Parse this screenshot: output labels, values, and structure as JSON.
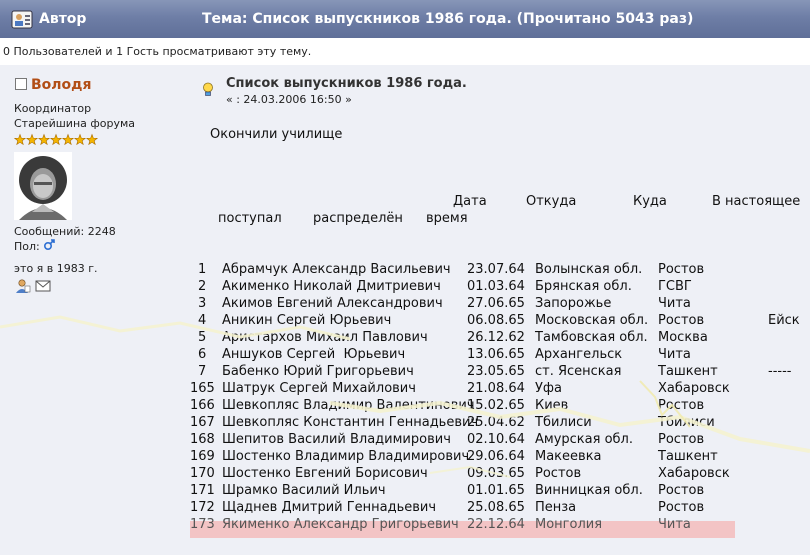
{
  "header": {
    "author_label": "Автор",
    "topic_title": "Тема: Список выпускников 1986 года.  (Прочитано 5043 раз)"
  },
  "viewers_text": "0 Пользователей и 1 Гость просматривают эту тему.",
  "author": {
    "name": "Володя",
    "role": "Координатор",
    "rank": "Старейшина форума",
    "stars_count": 7,
    "messages": "Сообщений: 2248",
    "gender_label": "Пол:",
    "caption": "это я в 1983 г."
  },
  "post": {
    "title": "Список выпускников 1986 года.",
    "date": "« : 24.03.2006 16:50 »",
    "intro": "Окончили училище",
    "header1": {
      "date": "Дата",
      "from": "Откуда",
      "to": "Куда",
      "now": "В настоящее"
    },
    "header2": {
      "entered": "поступал",
      "assigned": "распределён",
      "time": "время"
    },
    "rows": [
      {
        "n": "1",
        "name": "Абрамчук Александр Васильевич",
        "date": "23.07.64",
        "from": "Волынская обл.",
        "to": "Ростов",
        "now": ""
      },
      {
        "n": "2",
        "name": "Акименко Николай Дмитриевич",
        "date": "01.03.64",
        "from": "Брянская обл.",
        "to": "ГСВГ",
        "now": ""
      },
      {
        "n": "3",
        "name": "Акимов Евгений Александрович",
        "date": "27.06.65",
        "from": "Запорожье",
        "to": "Чита",
        "now": ""
      },
      {
        "n": "4",
        "name": "Аникин Сергей Юрьевич",
        "date": "06.08.65",
        "from": "Московская обл.",
        "to": "Ростов",
        "now": "Ейск"
      },
      {
        "n": "5",
        "name": "Аристархов Михаил Павлович",
        "date": "26.12.62",
        "from": "Тамбовская обл.",
        "to": "Москва",
        "now": ""
      },
      {
        "n": "6",
        "name": "Аншуков Сергей  Юрьевич",
        "date": "13.06.65",
        "from": "Архангельск",
        "to": "Чита",
        "now": ""
      },
      {
        "n": "7",
        "name": "Бабенко Юрий Григорьевич",
        "date": "23.05.65",
        "from": "ст. Ясенская",
        "to": "Ташкент",
        "now": "-----"
      },
      {
        "n": "165",
        "name": "Шатрук Сергей Михайлович",
        "date": "21.08.64",
        "from": "Уфа",
        "to": "Хабаровск",
        "now": ""
      },
      {
        "n": "166",
        "name": "Шевкопляс Владимир Валентинович",
        "date": "15.02.65",
        "from": "Киев",
        "to": "Ростов",
        "now": ""
      },
      {
        "n": "167",
        "name": "Шевкопляс Константин Геннадьевич",
        "date": "25.04.62",
        "from": "Тбилиси",
        "to": "Тбилиси",
        "now": ""
      },
      {
        "n": "168",
        "name": "Шепитов Василий Владимирович",
        "date": "02.10.64",
        "from": "Амурская обл.",
        "to": "Ростов",
        "now": ""
      },
      {
        "n": "169",
        "name": "Шостенко Владимир Владимирович",
        "date": "29.06.64",
        "from": "Макеевка",
        "to": "Ташкент",
        "now": ""
      },
      {
        "n": "170",
        "name": "Шостенко Евгений Борисович",
        "date": "09.03.65",
        "from": "Ростов",
        "to": "Хабаровск",
        "now": ""
      },
      {
        "n": "171",
        "name": "Шрамко Василий Ильич",
        "date": "01.01.65",
        "from": "Винницкая обл.",
        "to": "Ростов",
        "now": ""
      },
      {
        "n": "172",
        "name": "Щаднев Дмитрий Геннадьевич",
        "date": "25.08.65",
        "from": "Пенза",
        "to": "Ростов",
        "now": ""
      },
      {
        "n": "173",
        "name": "Якименко Александр Григорьевич",
        "date": "22.12.64",
        "from": "Монголия",
        "to": "Чита",
        "now": ""
      }
    ]
  },
  "colors": {
    "header_bg": "#6e7ea6",
    "post_bg": "#eef0f6",
    "username": "#b24e16",
    "highlight_row": "#f3c4c5",
    "star": "#f4b400"
  },
  "icons": [
    "author-avatar-icon",
    "checkbox-icon",
    "male-gender-icon",
    "profile-icon",
    "email-icon",
    "lightbulb-icon",
    "star-icon"
  ]
}
